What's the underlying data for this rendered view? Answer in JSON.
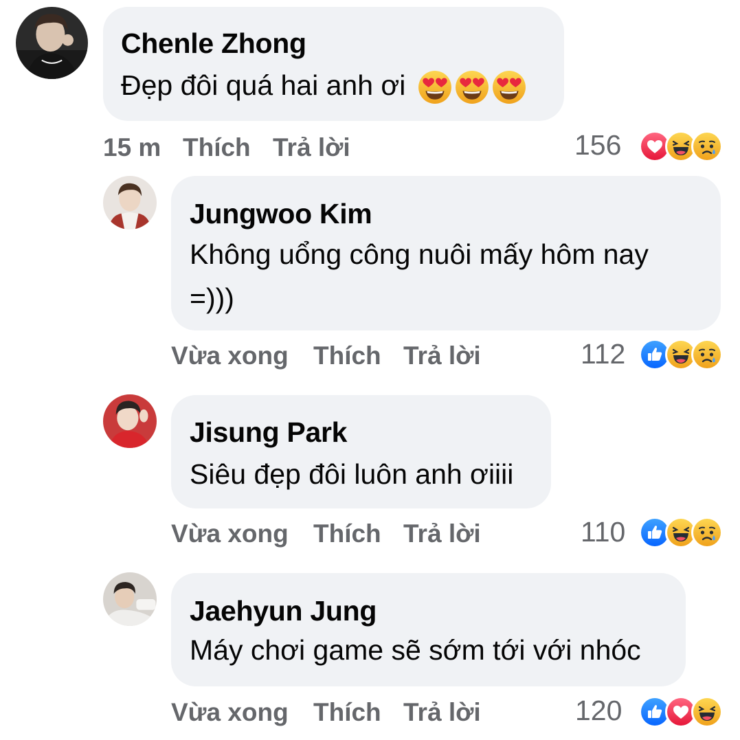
{
  "comments": [
    {
      "author": "Chenle Zhong",
      "text": "Đẹp đôi quá hai anh ơi",
      "emojis": [
        "heart-eyes",
        "heart-eyes",
        "heart-eyes"
      ],
      "time": "15 m",
      "like_label": "Thích",
      "reply_label": "Trả lời",
      "reaction_count": "156",
      "reactions": [
        "love",
        "haha",
        "sad"
      ]
    },
    {
      "author": "Jungwoo Kim",
      "text_line1": "Không uổng công nuôi mấy hôm nay",
      "text_line2": "=)))",
      "time": "Vừa xong",
      "like_label": "Thích",
      "reply_label": "Trả lời",
      "reaction_count": "112",
      "reactions": [
        "like",
        "haha",
        "sad"
      ]
    },
    {
      "author": "Jisung Park",
      "text": "Siêu đẹp đôi luôn anh ơiiii",
      "time": "Vừa xong",
      "like_label": "Thích",
      "reply_label": "Trả lời",
      "reaction_count": "110",
      "reactions": [
        "like",
        "haha",
        "sad"
      ]
    },
    {
      "author": "Jaehyun Jung",
      "text": "Máy chơi game sẽ sớm tới với nhóc",
      "time": "Vừa xong",
      "like_label": "Thích",
      "reply_label": "Trả lời",
      "reaction_count": "120",
      "reactions": [
        "like",
        "love",
        "haha"
      ]
    }
  ],
  "colors": {
    "bubble": "#f0f2f5",
    "meta_text": "#65676b",
    "like_blue": "#1877f2",
    "love_red": "#f33e58",
    "emoji_yellow": "#f7b125"
  }
}
